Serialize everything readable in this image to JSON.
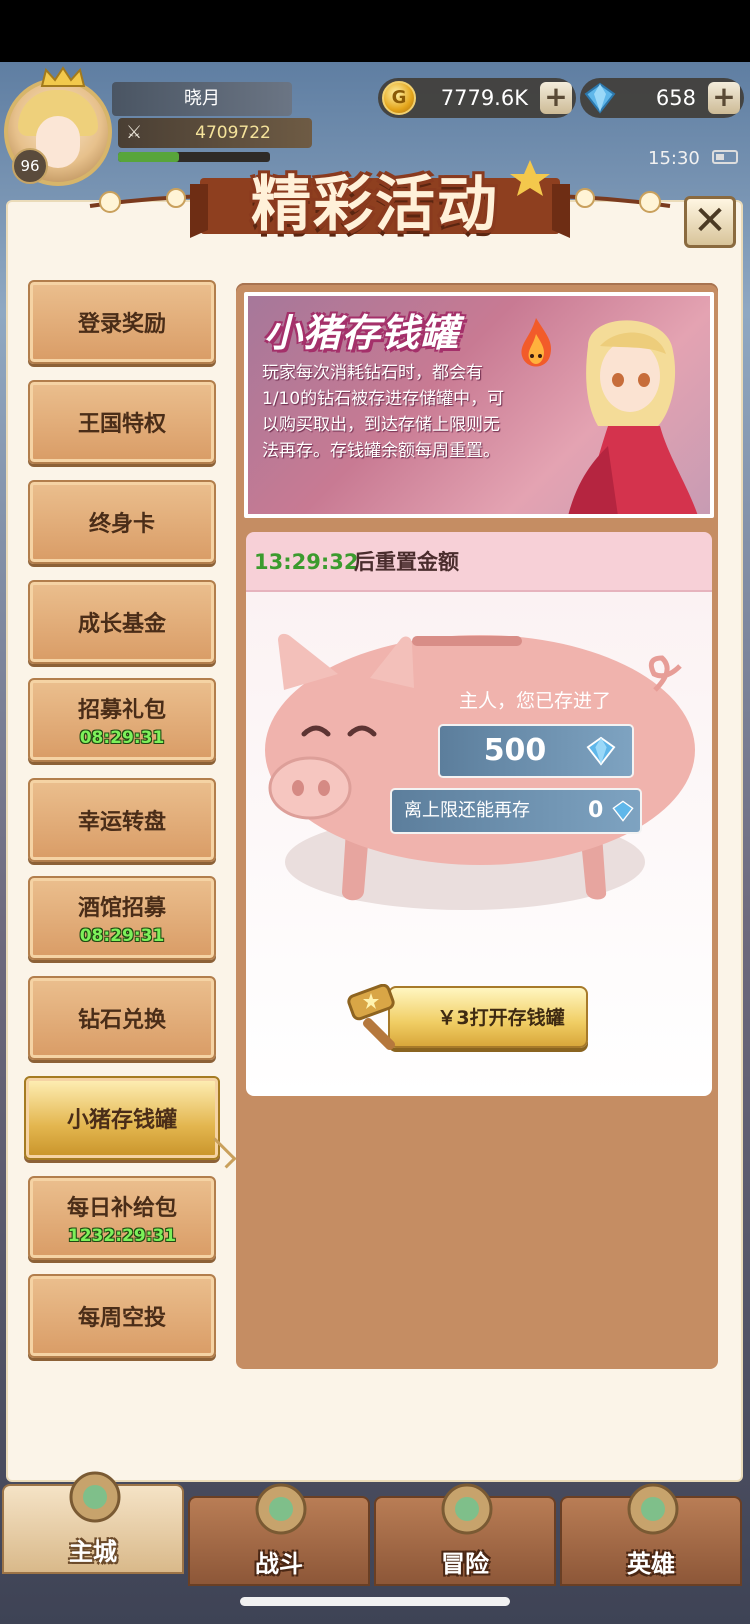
{
  "player": {
    "name": "晓月",
    "level": "96",
    "power": "4709722",
    "exp_fraction": 0.4
  },
  "currency": {
    "gold": "7779.6K",
    "gems": "658"
  },
  "clock": "15:30",
  "banner_title": "精彩活动",
  "tabs": [
    {
      "label": "登录奖励",
      "timer": ""
    },
    {
      "label": "王国特权",
      "timer": ""
    },
    {
      "label": "终身卡",
      "timer": ""
    },
    {
      "label": "成长基金",
      "timer": ""
    },
    {
      "label": "招募礼包",
      "timer": "08:29:31"
    },
    {
      "label": "幸运转盘",
      "timer": ""
    },
    {
      "label": "酒馆招募",
      "timer": "08:29:31"
    },
    {
      "label": "钻石兑换",
      "timer": ""
    },
    {
      "label": "小猪存钱罐",
      "timer": ""
    },
    {
      "label": "每日补给包",
      "timer": "1232:29:31"
    },
    {
      "label": "每周空投",
      "timer": ""
    }
  ],
  "active_tab_index": 8,
  "piggy": {
    "title": "小猪存钱罐",
    "description": "玩家每次消耗钻石时，都会有1/10的钻石被存进存储罐中，可以购买取出，到达存储上限则无法再存。存钱罐余额每周重置。",
    "reset_timer": "13:29:32",
    "reset_text": "后重置金额",
    "saved_label": "主人，您已存进了",
    "saved_value": "500",
    "limit_label": "离上限还能再存",
    "limit_value": "0",
    "button_label": "￥3打开存钱罐"
  },
  "nav": [
    {
      "label": "主城",
      "active": true
    },
    {
      "label": "战斗",
      "active": false
    },
    {
      "label": "冒险",
      "active": false
    },
    {
      "label": "英雄",
      "active": false
    }
  ],
  "icons": {
    "close": "close-icon",
    "plus": "plus-icon",
    "coin": "coin-icon",
    "gem": "gem-icon",
    "power": "crossed-swords-icon",
    "hammer": "hammer-icon"
  },
  "colors": {
    "timer_green": "#3b9b2e",
    "tab_active": "#e3b64f",
    "panel_bg": "#c58d63"
  }
}
